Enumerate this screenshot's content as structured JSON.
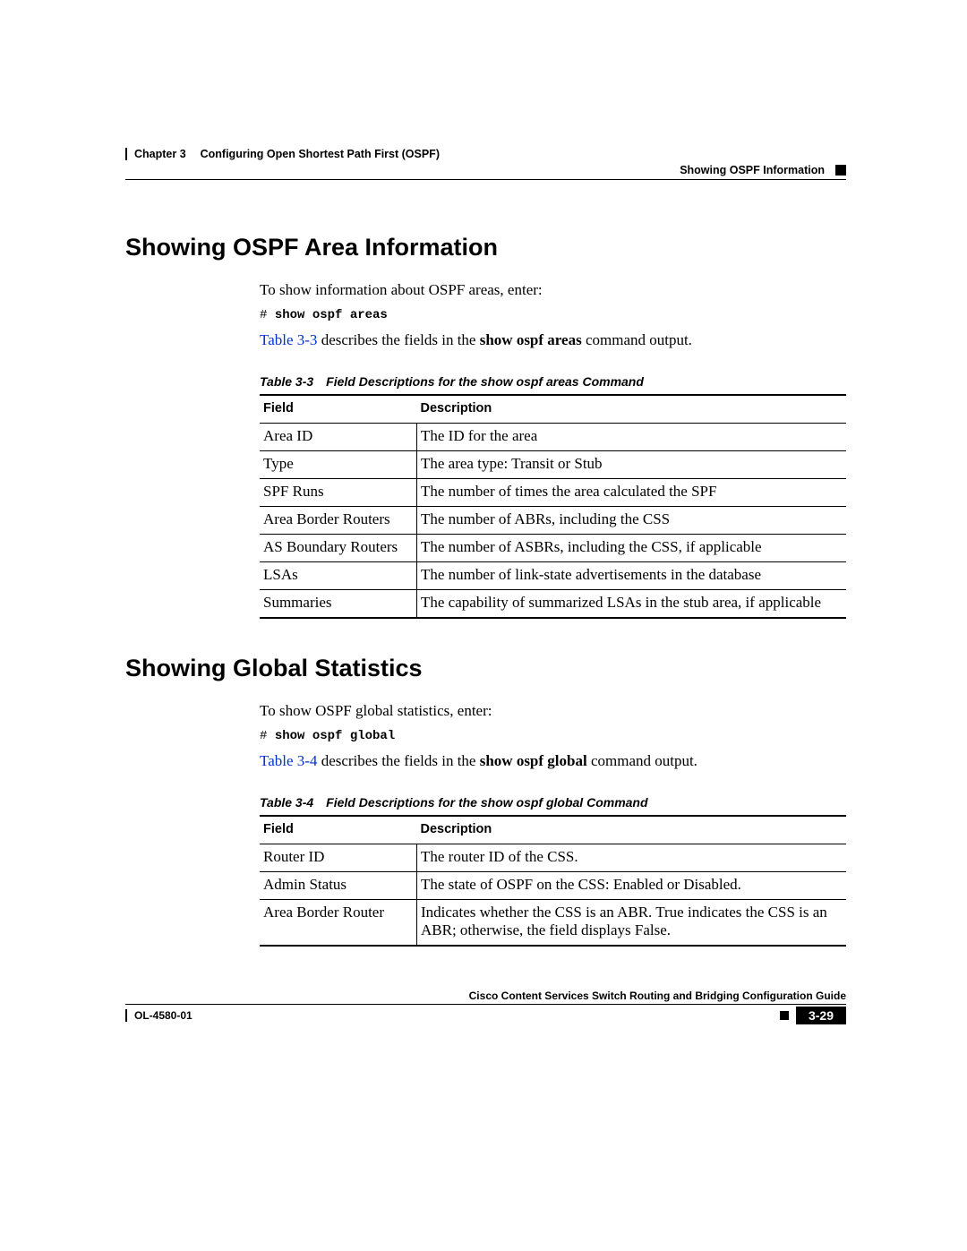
{
  "header": {
    "chapter_line": "Chapter 3  Configuring Open Shortest Path First (OSPF)",
    "section_line": "Showing OSPF Information"
  },
  "section_a": {
    "heading": "Showing OSPF Area Information",
    "intro": "To show information about OSPF areas, enter:",
    "prompt": "# ",
    "command": "show ospf areas",
    "desc_pre_link": "Table 3-3",
    "desc_mid": " describes the fields in the ",
    "desc_cmd": "show ospf areas",
    "desc_end": " command output.",
    "table_caption": "Table 3-3 Field Descriptions for the show ospf areas Command",
    "col_field": "Field",
    "col_desc": "Description",
    "rows": [
      {
        "field": "Area ID",
        "desc": "The ID for the area"
      },
      {
        "field": "Type",
        "desc": "The area type: Transit or Stub"
      },
      {
        "field": "SPF Runs",
        "desc": "The number of times the area calculated the SPF"
      },
      {
        "field": "Area Border Routers",
        "desc": "The number of ABRs, including the CSS"
      },
      {
        "field": "AS Boundary Routers",
        "desc": "The number of ASBRs, including the CSS, if applicable"
      },
      {
        "field": "LSAs",
        "desc": "The number of link-state advertisements in the database"
      },
      {
        "field": "Summaries",
        "desc": "The capability of summarized LSAs in the stub area, if applicable"
      }
    ]
  },
  "section_b": {
    "heading": "Showing Global Statistics",
    "intro": "To show OSPF global statistics, enter:",
    "prompt": "# ",
    "command": "show ospf global",
    "desc_pre_link": "Table 3-4",
    "desc_mid": " describes the fields in the ",
    "desc_cmd": "show ospf global",
    "desc_end": " command output.",
    "table_caption": "Table 3-4 Field Descriptions for the show ospf global Command",
    "col_field": "Field",
    "col_desc": "Description",
    "rows": [
      {
        "field": "Router ID",
        "desc": "The router ID of the CSS."
      },
      {
        "field": "Admin Status",
        "desc": "The state of OSPF on the CSS: Enabled or Disabled."
      },
      {
        "field": "Area Border Router",
        "desc": "Indicates whether the CSS is an ABR. True indicates the CSS is an ABR; otherwise, the field displays False."
      }
    ]
  },
  "footer": {
    "guide_title": "Cisco Content Services Switch Routing and Bridging Configuration Guide",
    "doc_id": "OL-4580-01",
    "page_num": "3-29"
  }
}
